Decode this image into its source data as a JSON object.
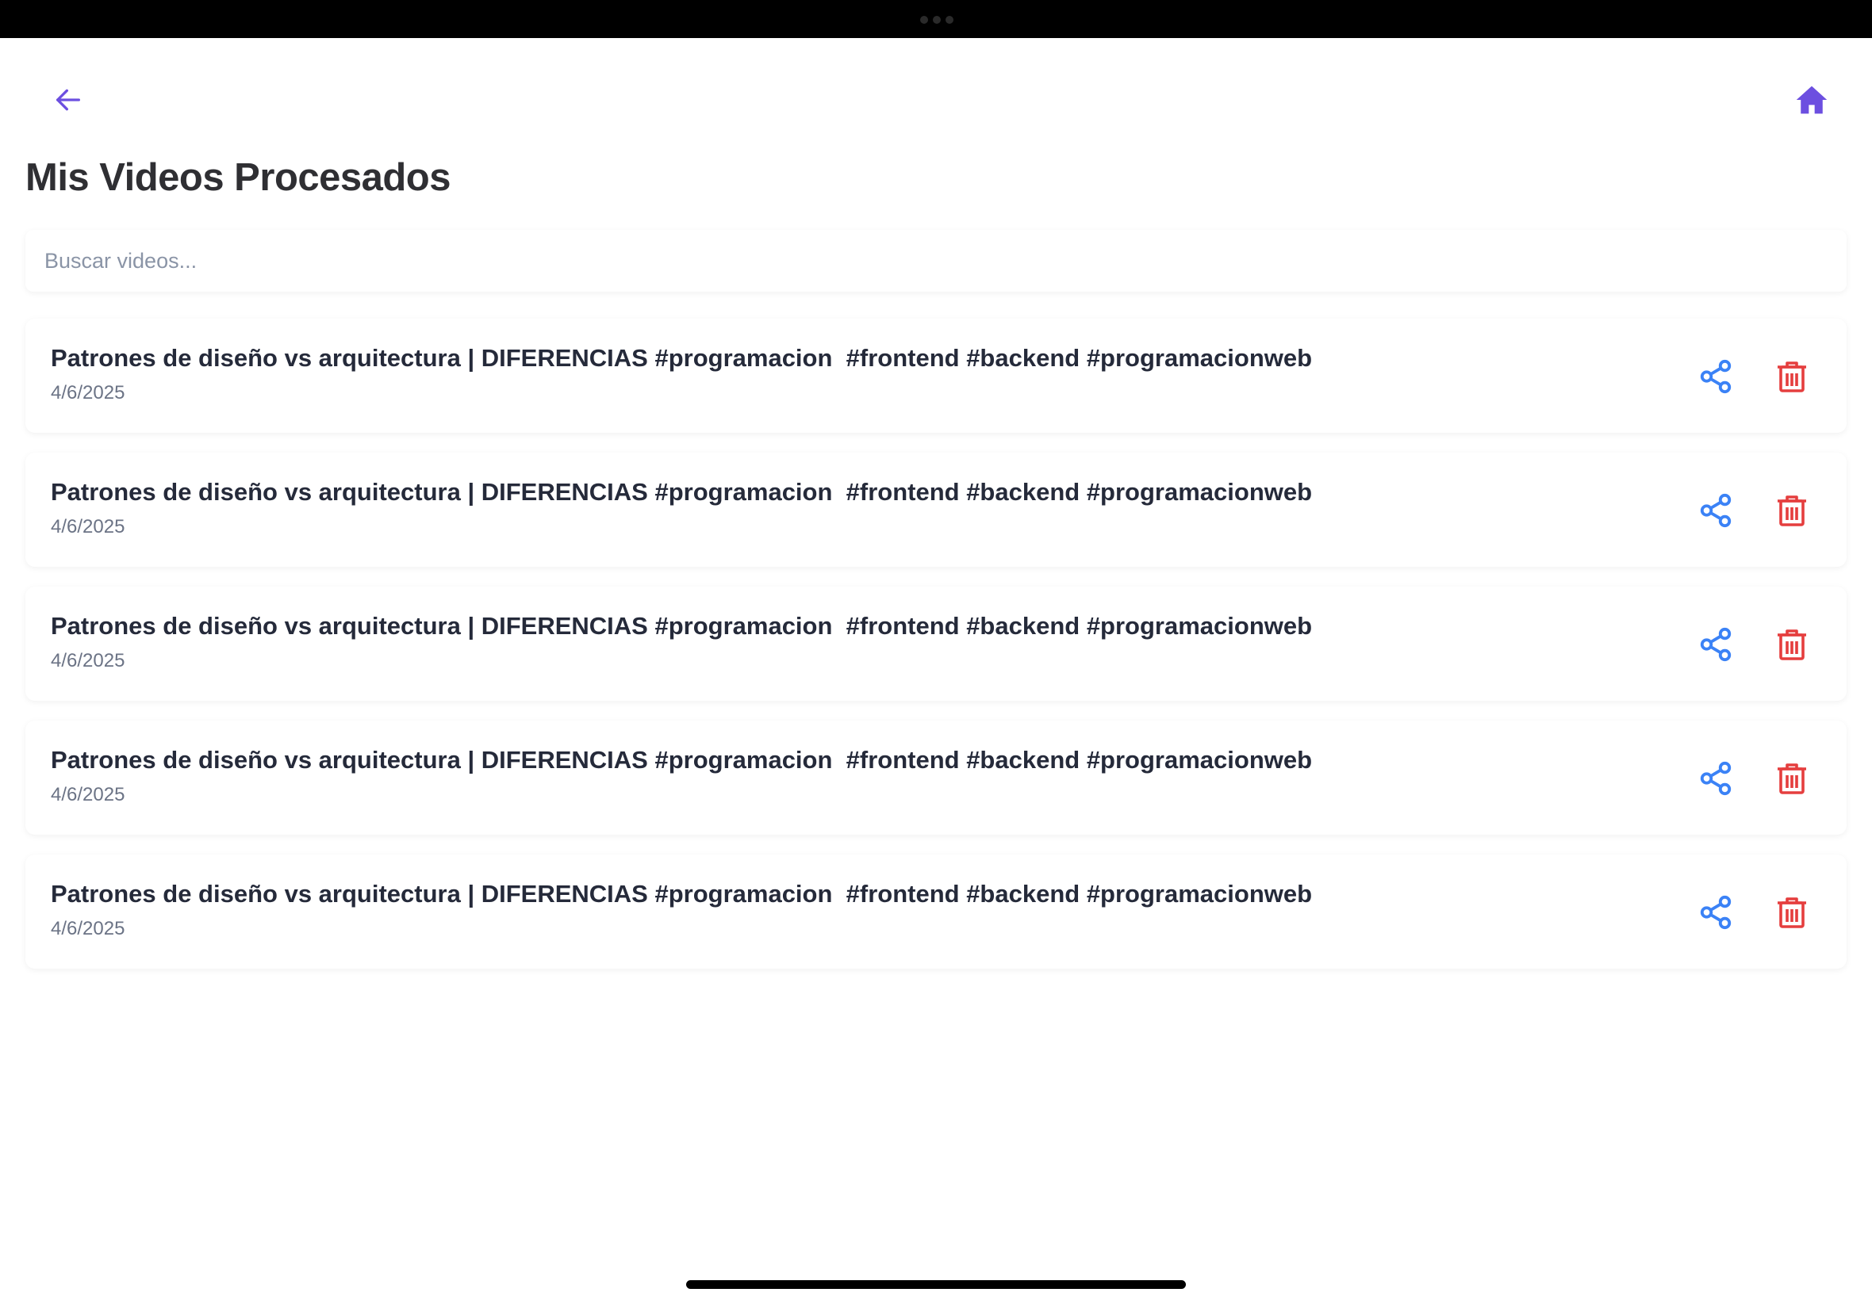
{
  "header": {
    "back_icon": "arrow-left-icon",
    "home_icon": "home-icon",
    "accent_color": "#6c4fe0"
  },
  "page": {
    "title": "Mis Videos Procesados"
  },
  "search": {
    "placeholder": "Buscar videos...",
    "value": ""
  },
  "videos": [
    {
      "title": "Patrones de diseño vs arquitectura | DIFERENCIAS #programacion  #frontend #backend #programacionweb",
      "date": "4/6/2025"
    },
    {
      "title": "Patrones de diseño vs arquitectura | DIFERENCIAS #programacion  #frontend #backend #programacionweb",
      "date": "4/6/2025"
    },
    {
      "title": "Patrones de diseño vs arquitectura | DIFERENCIAS #programacion  #frontend #backend #programacionweb",
      "date": "4/6/2025"
    },
    {
      "title": "Patrones de diseño vs arquitectura | DIFERENCIAS #programacion  #frontend #backend #programacionweb",
      "date": "4/6/2025"
    },
    {
      "title": "Patrones de diseño vs arquitectura | DIFERENCIAS #programacion  #frontend #backend #programacionweb",
      "date": "4/6/2025"
    }
  ],
  "actions": {
    "share_icon": "share-icon",
    "share_color": "#3b82f6",
    "delete_icon": "trash-icon",
    "delete_color": "#e53e3e"
  }
}
